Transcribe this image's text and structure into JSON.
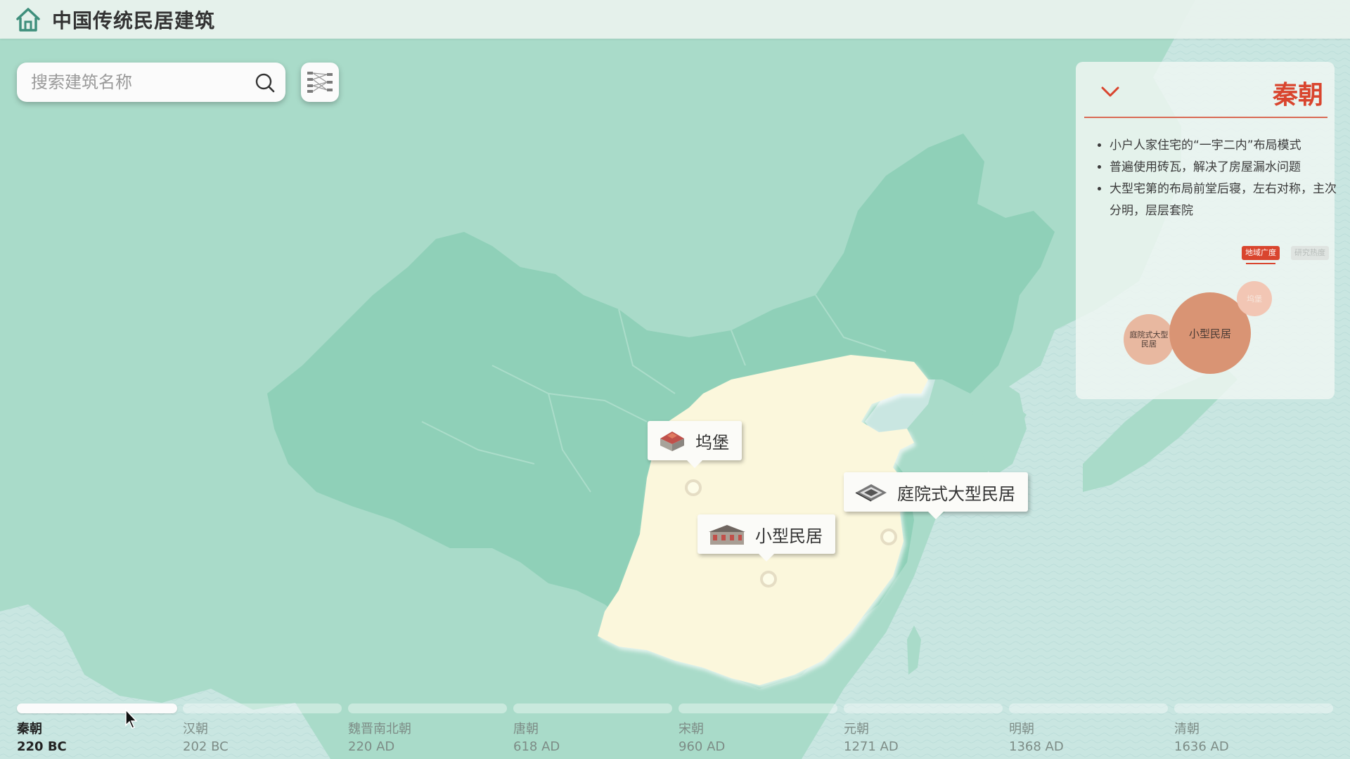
{
  "app": {
    "title": "中国传统民居建筑",
    "home_icon": "home-icon"
  },
  "search": {
    "placeholder": "搜索建筑名称",
    "value": "",
    "icon": "search-icon"
  },
  "toolbar": {
    "filter_icon": "network-filter-icon"
  },
  "markers": [
    {
      "label": "坞堡",
      "icon": "fortress-building-icon"
    },
    {
      "label": "庭院式大型民居",
      "icon": "courtyard-house-icon"
    },
    {
      "label": "小型民居",
      "icon": "small-house-icon"
    }
  ],
  "panel": {
    "title": "秦朝",
    "collapse_icon": "chevron-down-icon",
    "bullets": [
      "小户人家住宅的“一宇二内”布局模式",
      "普遍使用砖瓦，解决了房屋漏水问题",
      "大型宅第的布局前堂后寝，左右对称，主次分明，层层套院"
    ],
    "tabs": [
      {
        "label": "地域广度",
        "active": true
      },
      {
        "label": "研究热度",
        "active": false
      }
    ],
    "bubbles": [
      {
        "label": "庭院式大型民居",
        "color": "#e8b8a0"
      },
      {
        "label": "小型民居",
        "color": "#d99474"
      },
      {
        "label": "坞堡",
        "color": "#f2c6b4"
      }
    ]
  },
  "timeline": {
    "active_index": 0,
    "items": [
      {
        "name": "秦朝",
        "year": "220 BC"
      },
      {
        "name": "汉朝",
        "year": "202 BC"
      },
      {
        "name": "魏晋南北朝",
        "year": "220 AD"
      },
      {
        "name": "唐朝",
        "year": "618 AD"
      },
      {
        "name": "宋朝",
        "year": "960 AD"
      },
      {
        "name": "元朝",
        "year": "1271 AD"
      },
      {
        "name": "明朝",
        "year": "1368 AD"
      },
      {
        "name": "清朝",
        "year": "1636 AD"
      }
    ]
  },
  "colors": {
    "accent": "#d9452e",
    "land": "#8fd0b8",
    "highlight_region": "#fbf7dc",
    "sea": "#c6e5e0"
  }
}
